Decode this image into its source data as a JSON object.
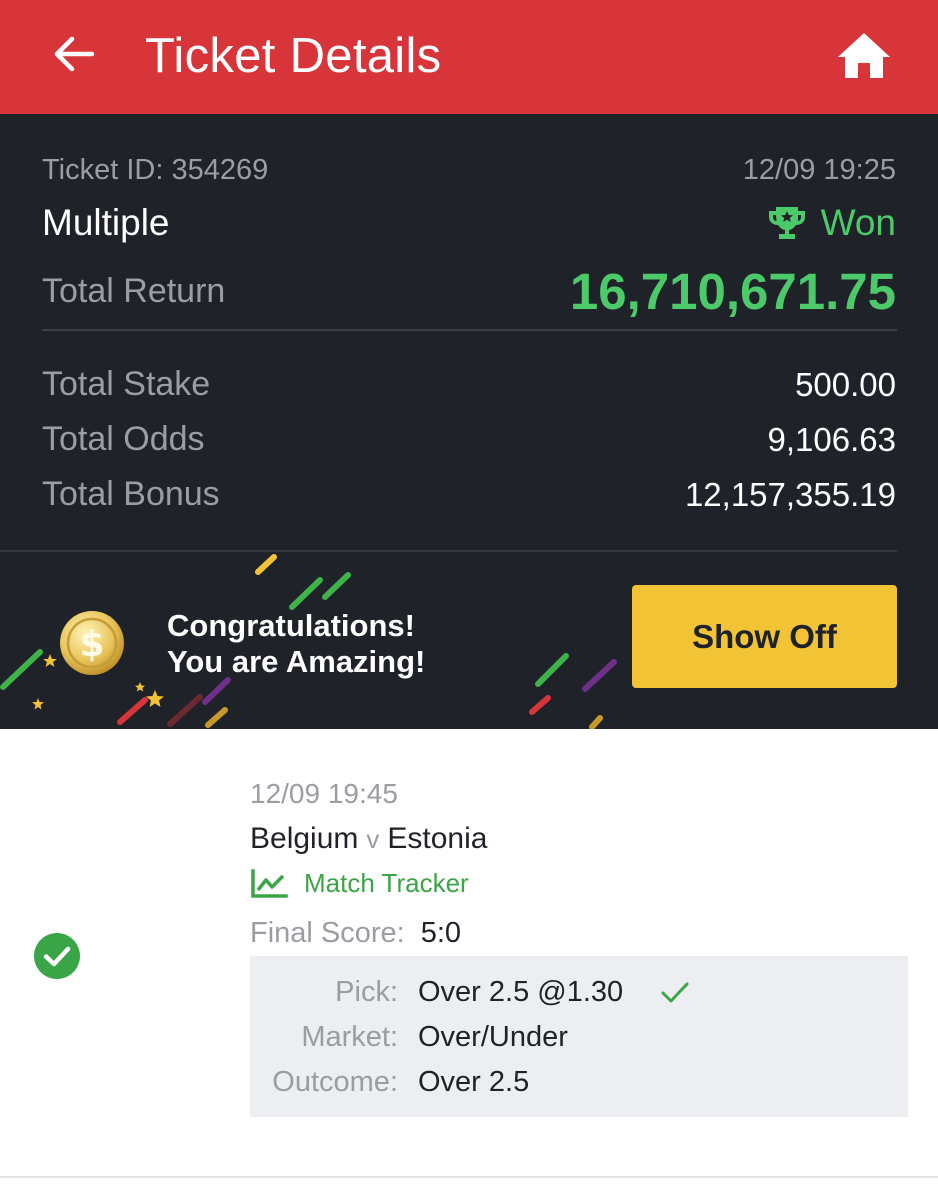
{
  "header": {
    "title": "Ticket Details",
    "back_icon": "arrow-left-icon",
    "home_icon": "home-icon",
    "background": "#d7353a"
  },
  "ticket": {
    "id_text": "Ticket ID: 354269",
    "datetime": "12/09 19:25",
    "bet_type": "Multiple",
    "status": "Won",
    "status_icon": "trophy-icon",
    "total_return_label": "Total Return",
    "total_return_value": "16,710,671.75",
    "stats": [
      {
        "label": "Total Stake",
        "value": "500.00"
      },
      {
        "label": "Total Odds",
        "value": "9,106.63"
      },
      {
        "label": "Total Bonus",
        "value": "12,157,355.19"
      }
    ]
  },
  "banner": {
    "line1": "Congratulations!",
    "line2": "You are Amazing!",
    "button_label": "Show Off",
    "button_color": "#f2c335",
    "coin_icon": "dollar-coin-icon"
  },
  "event": {
    "datetime": "12/09 19:45",
    "home_team": "Belgium",
    "vs": "v",
    "away_team": "Estonia",
    "tracker_label": "Match Tracker",
    "tracker_icon": "line-chart-icon",
    "final_score_label": "Final Score:",
    "final_score_value": "5:0",
    "result_icon": "check-circle-icon",
    "pick_label": "Pick:",
    "pick_value": "Over 2.5 @1.30",
    "market_label": "Market:",
    "market_value": "Over/Under",
    "outcome_label": "Outcome:",
    "outcome_value": "Over 2.5"
  },
  "colors": {
    "accent_green": "#4cc968",
    "dark_panel": "#1f2229"
  }
}
